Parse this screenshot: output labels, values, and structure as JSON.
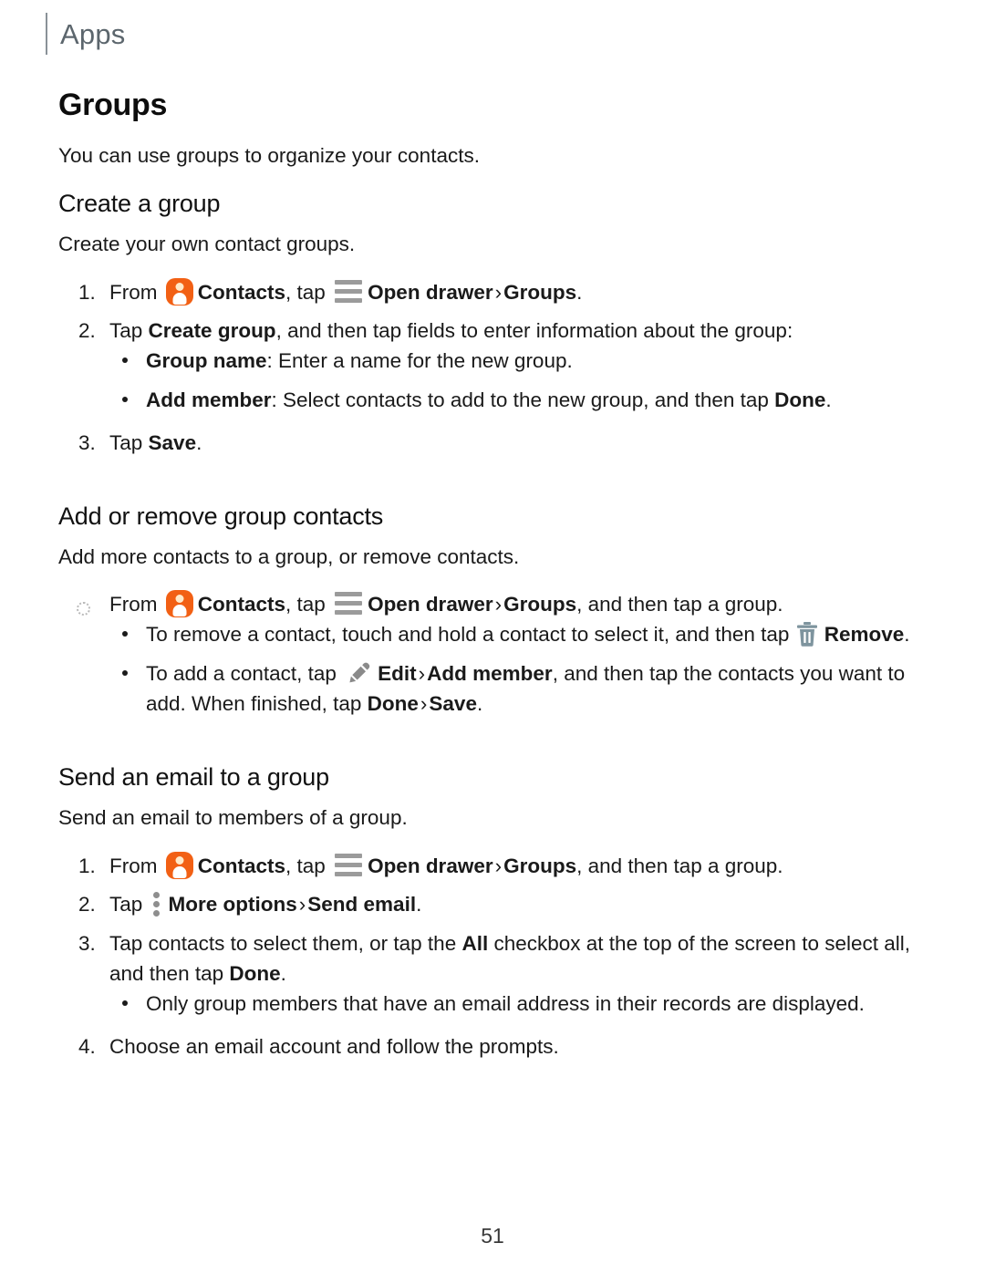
{
  "header": {
    "label": "Apps"
  },
  "page_number": "51",
  "colors": {
    "contacts_icon_orange": "#f26014",
    "contacts_icon_head": "#ffe9c9",
    "drawer_icon_gray": "#9b9b9b",
    "trash_icon_gray": "#7e949e",
    "pencil_icon_gray": "#8a8a8a",
    "more_icon_gray": "#8e8e8e",
    "header_rule_gray": "#8a9298",
    "header_text_gray": "#5c666d",
    "body_text": "#1a1a1a"
  },
  "icons": {
    "contacts": "contacts-app-icon",
    "open_drawer": "hamburger-menu-icon",
    "remove": "trash-icon",
    "edit": "pencil-icon",
    "more_options": "more-options-icon"
  },
  "section": {
    "title": "Groups",
    "intro": "You can use groups to organize your contacts."
  },
  "create_group": {
    "title": "Create a group",
    "intro": "Create your own contact groups.",
    "step1": {
      "marker": "1.",
      "t1": "From ",
      "contacts": "Contacts",
      "t2": ", tap ",
      "open_drawer": "Open drawer",
      "chevron": "›",
      "groups": "Groups",
      "t3": "."
    },
    "step2": {
      "marker": "2.",
      "t1": "Tap ",
      "create_group": "Create group",
      "t2": ", and then tap fields to enter information about the group:"
    },
    "step2_bullets": [
      {
        "bold": "Group name",
        "rest": ": Enter a name for the new group."
      },
      {
        "bold": "Add member",
        "rest": ": Select contacts to add to the new group, and then tap ",
        "bold_end": "Done",
        "tail": "."
      }
    ],
    "step3": {
      "marker": "3.",
      "t1": "Tap ",
      "save": "Save",
      "t2": "."
    }
  },
  "add_remove": {
    "title": "Add or remove group contacts",
    "intro": "Add more contacts to a group, or remove contacts.",
    "step1": {
      "marker": "hollow-circle",
      "t1": "From ",
      "contacts": "Contacts",
      "t2": ", tap ",
      "open_drawer": "Open drawer",
      "chevron": "›",
      "groups": "Groups",
      "t3": ", and then tap a group."
    },
    "bullets": [
      {
        "t1": "To remove a contact, touch and hold a contact to select it, and then tap ",
        "bold": "Remove",
        "t2": "."
      },
      {
        "t1": "To add a contact, tap ",
        "bold": "Edit",
        "chevron": "›",
        "bold2": "Add member",
        "t2": ", and then tap the contacts you want to add. When finished, tap ",
        "bold3": "Done",
        "chevron2": "›",
        "bold4": "Save",
        "t3": "."
      }
    ]
  },
  "send_email": {
    "title": "Send an email to a group",
    "intro": "Send an email to members of a group.",
    "step1": {
      "marker": "1.",
      "t1": "From ",
      "contacts": "Contacts",
      "t2": ", tap ",
      "open_drawer": "Open drawer",
      "chevron": "›",
      "groups": "Groups",
      "t3": ", and then tap a group."
    },
    "step2": {
      "marker": "2.",
      "t1": "Tap ",
      "more_options": "More options",
      "chevron": "›",
      "send_email": "Send email",
      "t2": "."
    },
    "step3": {
      "marker": "3.",
      "t1": "Tap contacts to select them, or tap the ",
      "all": "All",
      "t2": " checkbox at the top of the screen to select all, and then tap ",
      "done": "Done",
      "t3": "."
    },
    "step3_bullet": {
      "text": "Only group members that have an email address in their records are displayed."
    },
    "step4": {
      "marker": "4.",
      "text": "Choose an email account and follow the prompts."
    }
  }
}
